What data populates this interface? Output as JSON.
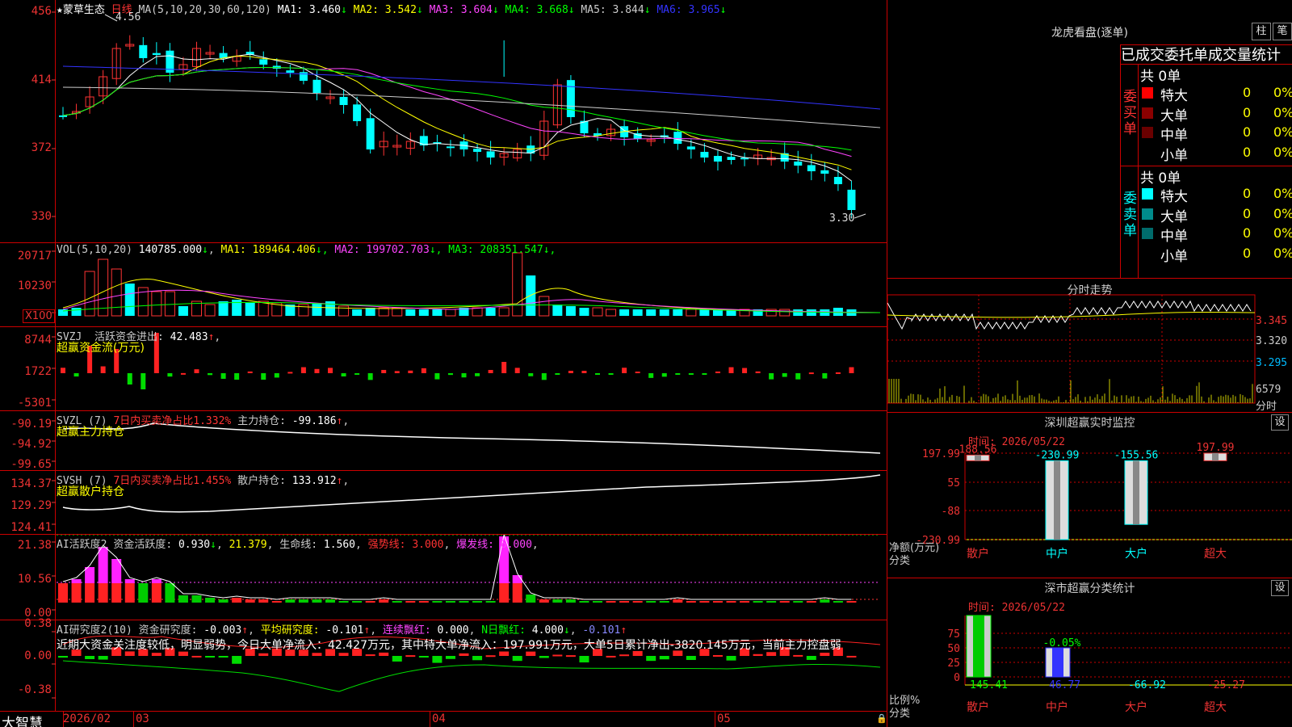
{
  "stock_name": "蒙草生态",
  "period": "日线",
  "price_header": {
    "ma_def": "MA(5,10,20,30,60,120)",
    "items": [
      {
        "label": "MA1:",
        "value": "3.460",
        "arrow": "↓",
        "color": "#ffffff"
      },
      {
        "label": "MA2:",
        "value": "3.542",
        "arrow": "↓",
        "color": "#ffff00"
      },
      {
        "label": "MA3:",
        "value": "3.604",
        "arrow": "↓",
        "color": "#ff44ff"
      },
      {
        "label": "MA4:",
        "value": "3.668",
        "arrow": "↓",
        "color": "#00ff00"
      },
      {
        "label": "MA5:",
        "value": "3.844",
        "arrow": "↓",
        "color": "#cccccc"
      },
      {
        "label": "MA6:",
        "value": "3.965",
        "arrow": "↓",
        "color": "#3333ff"
      }
    ],
    "y_ticks": [
      "456",
      "414",
      "372",
      "330"
    ],
    "high_label": "4.56",
    "low_label": "3.30"
  },
  "vol_header": {
    "def": "VOL(5,10,20)",
    "value": "140785.000",
    "items": [
      {
        "label": "MA1:",
        "value": "189464.406",
        "arrow": "↓",
        "color": "#ffff00"
      },
      {
        "label": "MA2:",
        "value": "199702.703",
        "arrow": "↓",
        "color": "#ff44ff"
      },
      {
        "label": "MA3:",
        "value": "208351.547",
        "arrow": "↓",
        "color": "#00ff00"
      }
    ],
    "y_ticks": [
      "20717",
      "10230"
    ],
    "unit": "X100"
  },
  "svzj": {
    "title": "SVZJ",
    "label": "活跃资金进出:",
    "value": "42.483",
    "sub": "超赢资金流(万元)",
    "y_ticks": [
      "8744",
      "1722",
      "-5301"
    ]
  },
  "svzl": {
    "title": "SVZL (7)",
    "label1": "7日内买卖净占比1.332%",
    "label2": "主力持仓:",
    "value": "-99.186",
    "sub": "超赢主力持仓",
    "y_ticks": [
      "-90.19",
      "-94.92",
      "-99.65"
    ]
  },
  "svsh": {
    "title": "SVSH (7)",
    "label1": "7日内买卖净占比1.455%",
    "label2": "散户持仓:",
    "value": "133.912",
    "sub": "超赢散户持仓",
    "y_ticks": [
      "134.37",
      "129.29",
      "124.41"
    ]
  },
  "ai_active": {
    "title": "AI活跃度2",
    "label": "资金活跃度:",
    "value": "0.930",
    "v2": "21.379",
    "life_label": "生命线:",
    "life": "1.560",
    "strong_label": "强势线:",
    "strong": "3.000",
    "burst_label": "爆发线:",
    "burst": "6.000",
    "y_ticks": [
      "21.38",
      "10.56",
      "0.00"
    ]
  },
  "ai_research": {
    "title": "AI研究度2(10)",
    "label": "资金研究度:",
    "value": "-0.003",
    "avg_label": "平均研究度:",
    "avg": "-0.101",
    "red_label": "连续飘红:",
    "red": "0.000",
    "n_label": "N日飘红:",
    "n": "4.000",
    "last": "-0.101",
    "comment": "近期大资金关注度较低，明显弱势，今日大单净流入：42.427万元，其中特大单净流入：197.991万元，大单5日累计净出-3820.145万元，当前主力控盘弱",
    "y_ticks": [
      "0.38",
      "0.00",
      "-0.38"
    ]
  },
  "x_axis": {
    "labels": [
      "2026/02",
      "03",
      "04",
      "05"
    ]
  },
  "brand": "大智慧",
  "dragon": {
    "title": "龙虎看盘(逐单)",
    "btn1": "柱",
    "btn2": "笔",
    "header": "已成交委托单成交量统计",
    "buy_side": "委买单",
    "sell_side": "委卖单",
    "buy_total": "共 0单",
    "sell_total": "共 0单",
    "buy_rows": [
      {
        "name": "特大",
        "val": "0",
        "pct": "0%",
        "color": "#ff0000"
      },
      {
        "name": "大单",
        "val": "0",
        "pct": "0%",
        "color": "#8b0000"
      },
      {
        "name": "中单",
        "val": "0",
        "pct": "0%",
        "color": "#6a0000"
      },
      {
        "name": "小单",
        "val": "0",
        "pct": "0%",
        "color": "#000000"
      }
    ],
    "sell_rows": [
      {
        "name": "特大",
        "val": "0",
        "pct": "0%",
        "color": "#00ffff"
      },
      {
        "name": "大单",
        "val": "0",
        "pct": "0%",
        "color": "#008b8b"
      },
      {
        "name": "中单",
        "val": "0",
        "pct": "0%",
        "color": "#006b6b"
      },
      {
        "name": "小单",
        "val": "0",
        "pct": "0%",
        "color": "#000000"
      }
    ]
  },
  "intraday": {
    "title": "分时走势",
    "y_labels": [
      "3.345",
      "3.320",
      "3.295"
    ],
    "vol_label": "6579",
    "unit": "分时"
  },
  "sz_monitor": {
    "title": "深圳超赢实时监控",
    "btn": "设",
    "time": "时间: 2026/05/22",
    "y_ticks": [
      "197.99",
      "55",
      "-88",
      "-230.99"
    ],
    "y_unit1": "净额(万元)",
    "y_unit2": "分类",
    "categories": [
      "散户",
      "中户",
      "大户",
      "超大"
    ],
    "values": [
      188.56,
      -230.99,
      -155.56,
      197.99
    ],
    "value_labels": [
      "188.56",
      "-230.99",
      "-155.56",
      "197.99"
    ]
  },
  "sz_class": {
    "title": "深市超赢分类统计",
    "btn": "设",
    "time": "时间: 2026/05/22",
    "y_ticks": [
      "75",
      "50",
      "25",
      "0"
    ],
    "y_unit1": "比例%",
    "y_unit2": "分类",
    "categories": [
      "散户",
      "中户",
      "大户",
      "超大"
    ],
    "values": [
      145.41,
      46.77,
      -66.92,
      -25.27
    ],
    "value_labels": [
      "145.41",
      "46.77",
      "-66.92",
      "-25.27"
    ],
    "top_label": "-0.05%"
  }
}
